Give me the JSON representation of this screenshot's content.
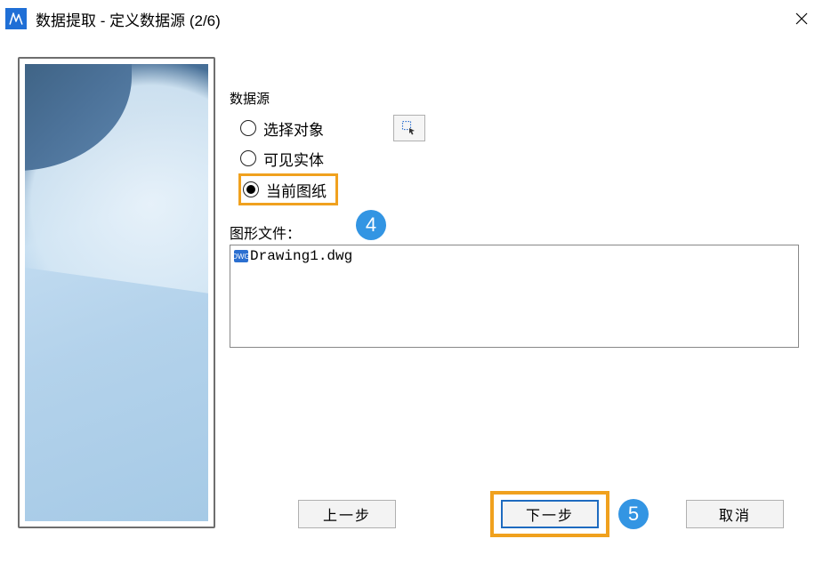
{
  "window": {
    "title": "数据提取 - 定义数据源 (2/6)"
  },
  "datasource": {
    "group_label": "数据源",
    "options": {
      "select_objects": "选择对象",
      "visible_entities": "可见实体",
      "current_drawing": "当前图纸"
    },
    "selected": "current_drawing"
  },
  "files": {
    "label": "图形文件：",
    "items": [
      "Drawing1.dwg"
    ]
  },
  "buttons": {
    "prev": "上一步",
    "next": "下一步",
    "cancel": "取消"
  },
  "callouts": {
    "radio": "4",
    "next": "5"
  }
}
